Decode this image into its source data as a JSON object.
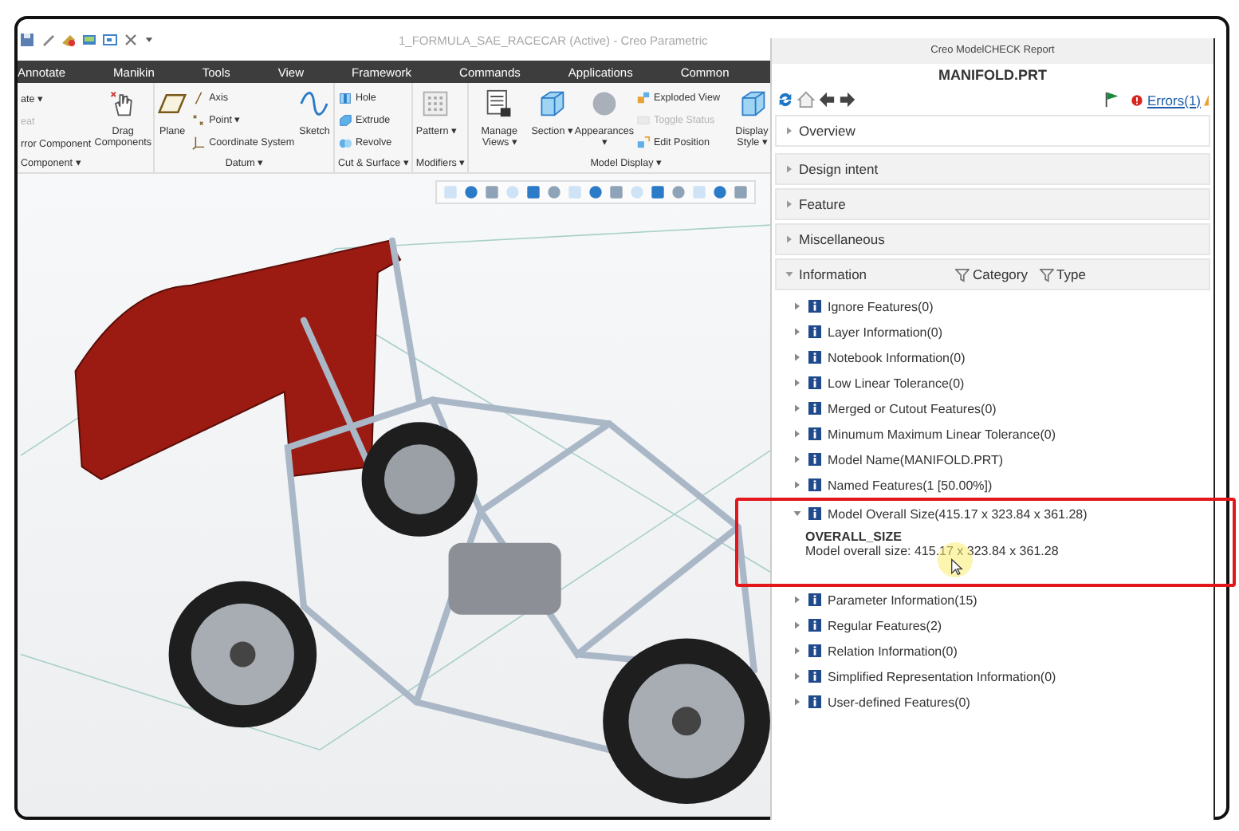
{
  "window": {
    "title": "1_FORMULA_SAE_RACECAR (Active) - Creo Parametric"
  },
  "ribbon_tabs": [
    "Annotate",
    "Manikin",
    "Tools",
    "View",
    "Framework",
    "Commands",
    "Applications",
    "Common"
  ],
  "ribbon_groups": [
    {
      "label": "Component ▾",
      "columns": [
        [
          {
            "kind": "small",
            "label": "ate ▾",
            "disabled": false
          },
          {
            "kind": "small",
            "label": "eat",
            "disabled": true
          },
          {
            "kind": "small",
            "label": "rror Component",
            "disabled": false
          }
        ],
        [
          {
            "kind": "large",
            "label": "Drag Components",
            "disabled": false
          }
        ]
      ]
    },
    {
      "label": "Datum ▾",
      "columns": [
        [
          {
            "kind": "large",
            "label": "Plane",
            "disabled": false
          }
        ],
        [
          {
            "kind": "small",
            "label": "Axis",
            "disabled": false
          },
          {
            "kind": "small",
            "label": "Point ▾",
            "disabled": false
          },
          {
            "kind": "small",
            "label": "Coordinate System",
            "disabled": false
          }
        ],
        [
          {
            "kind": "large",
            "label": "Sketch",
            "disabled": false
          }
        ]
      ]
    },
    {
      "label": "Cut & Surface ▾",
      "columns": [
        [
          {
            "kind": "small",
            "label": "Hole",
            "disabled": false
          },
          {
            "kind": "small",
            "label": "Extrude",
            "disabled": false
          },
          {
            "kind": "small",
            "label": "Revolve",
            "disabled": false
          }
        ]
      ]
    },
    {
      "label": "Modifiers ▾",
      "columns": [
        [
          {
            "kind": "large",
            "label": "Pattern ▾",
            "disabled": false
          }
        ]
      ]
    },
    {
      "label": "Model Display ▾",
      "columns": [
        [
          {
            "kind": "large",
            "label": "Manage Views ▾",
            "disabled": false
          }
        ],
        [
          {
            "kind": "large",
            "label": "Section ▾",
            "disabled": false
          }
        ],
        [
          {
            "kind": "large",
            "label": "Appearances ▾",
            "disabled": false
          }
        ],
        [
          {
            "kind": "small",
            "label": "Exploded View",
            "disabled": false
          },
          {
            "kind": "small",
            "label": "Toggle Status",
            "disabled": true
          },
          {
            "kind": "small",
            "label": "Edit Position",
            "disabled": false
          }
        ],
        [
          {
            "kind": "large",
            "label": "Display Style ▾",
            "disabled": false
          }
        ]
      ]
    }
  ],
  "report": {
    "title": "Creo ModelCHECK Report",
    "heading": "MANIFOLD.PRT",
    "errors_link": "Errors(1)",
    "sections": [
      {
        "label": "Overview",
        "expanded": false
      },
      {
        "label": "Design intent",
        "expanded": false
      },
      {
        "label": "Feature",
        "expanded": false
      },
      {
        "label": "Miscellaneous",
        "expanded": false
      },
      {
        "label": "Information",
        "expanded": true,
        "filters": [
          "Category",
          "Type"
        ],
        "items": [
          {
            "label": "Ignore Features(0)",
            "expanded": false,
            "highlighted": false
          },
          {
            "label": "Layer Information(0)",
            "expanded": false,
            "highlighted": false
          },
          {
            "label": "Notebook Information(0)",
            "expanded": false,
            "highlighted": false
          },
          {
            "label": "Low Linear Tolerance(0)",
            "expanded": false,
            "highlighted": false
          },
          {
            "label": "Merged or Cutout Features(0)",
            "expanded": false,
            "highlighted": false
          },
          {
            "label": "Minumum Maximum Linear Tolerance(0)",
            "expanded": false,
            "highlighted": false
          },
          {
            "label": "Model Name(MANIFOLD.PRT)",
            "expanded": false,
            "highlighted": false
          },
          {
            "label": "Named Features(1 [50.00%])",
            "expanded": false,
            "highlighted": false
          },
          {
            "label": "Model Overall Size(415.17 x 323.84 x 361.28)",
            "expanded": true,
            "highlighted": true,
            "detail": {
              "heading": "OVERALL_SIZE",
              "text": "Model overall size: 415.17 x 323.84 x 361.28"
            }
          },
          {
            "label": "Parameter Information(15)",
            "expanded": false,
            "highlighted": false
          },
          {
            "label": "Regular Features(2)",
            "expanded": false,
            "highlighted": false
          },
          {
            "label": "Relation Information(0)",
            "expanded": false,
            "highlighted": false
          },
          {
            "label": "Simplified Representation Information(0)",
            "expanded": false,
            "highlighted": false
          },
          {
            "label": "User-defined Features(0)",
            "expanded": false,
            "highlighted": false
          }
        ]
      }
    ]
  }
}
